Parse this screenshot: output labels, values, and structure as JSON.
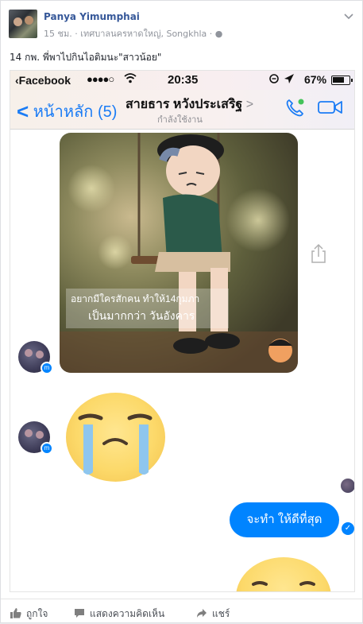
{
  "post": {
    "author": "Panya Yimumphai",
    "time": "15 ชม.",
    "location": "เทศบาลนครหาดใหญ่, Songkhla",
    "caption": "14 กพ. พี่พาไปกินไอติมนะ\"สาวน้อย\""
  },
  "phone": {
    "carrier": "Facebook",
    "signal": "●●●●○",
    "time": "20:35",
    "battery": "67%"
  },
  "chat": {
    "back_label": "หน้าหลัก (5)",
    "contact_name": "สายธาร หวังประเสริฐ",
    "contact_status": "กำลังใช้งาน",
    "sticker_line1": "อยากมีใครสักคน  ทำให้14กุมภา",
    "sticker_line2": "เป็นมากกว่า  วันอังคาร",
    "message": "จะทำ ให้ดีที่สุด"
  },
  "actions": {
    "like": "ถูกใจ",
    "comment": "แสดงความคิดเห็น",
    "share": "แชร์"
  },
  "colors": {
    "messenger_blue": "#0084ff",
    "ios_blue": "#1b7cf5",
    "author_link": "#365899"
  }
}
